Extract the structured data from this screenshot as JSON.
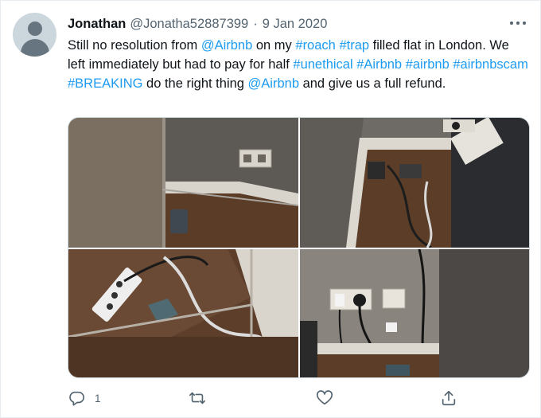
{
  "tweet": {
    "author_name": "Jonathan",
    "author_handle": "@Jonatha52887399",
    "separator": "·",
    "date": "9 Jan 2020",
    "text_segments": [
      {
        "t": "Still no resolution from ",
        "link": false
      },
      {
        "t": "@Airbnb",
        "link": true
      },
      {
        "t": " on my ",
        "link": false
      },
      {
        "t": "#roach",
        "link": true
      },
      {
        "t": " ",
        "link": false
      },
      {
        "t": "#trap",
        "link": true
      },
      {
        "t": " filled flat in London. We left immediately but had to pay for half ",
        "link": false
      },
      {
        "t": "#unethical",
        "link": true
      },
      {
        "t": " ",
        "link": false
      },
      {
        "t": "#Airbnb",
        "link": true
      },
      {
        "t": " ",
        "link": false
      },
      {
        "t": "#airbnb",
        "link": true
      },
      {
        "t": " ",
        "link": false
      },
      {
        "t": "#airbnbscam",
        "link": true
      },
      {
        "t": " ",
        "link": false
      },
      {
        "t": "#BREAKING",
        "link": true
      },
      {
        "t": " do the right thing ",
        "link": false
      },
      {
        "t": "@Airbnb",
        "link": true
      },
      {
        "t": " and give us a full refund.",
        "link": false
      }
    ],
    "reply_count": "1"
  },
  "icons": {
    "avatar": "default-avatar-icon",
    "more": "more-dots-icon",
    "reply": "reply-icon",
    "retweet": "retweet-icon",
    "like": "heart-icon",
    "share": "share-icon"
  },
  "colors": {
    "link": "#1d9bf0",
    "text": "#0f1419",
    "secondary": "#536471",
    "avatar_bg": "#ccd6dd"
  }
}
